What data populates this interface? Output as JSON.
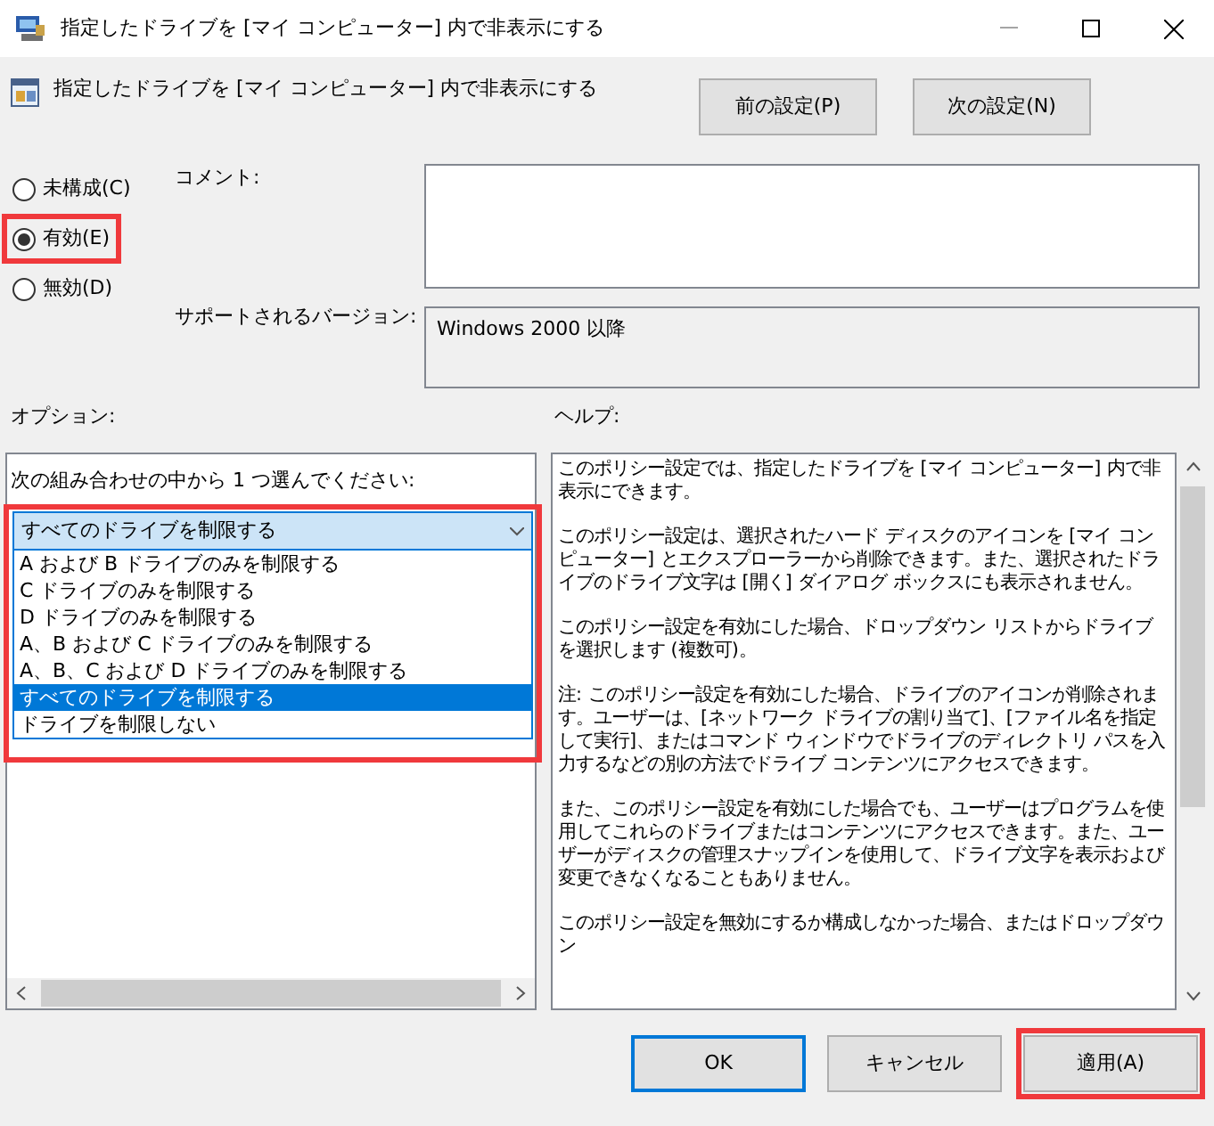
{
  "window": {
    "title": "指定したドライブを [マイ コンピューター] 内で非表示にする"
  },
  "header": {
    "policy_title": "指定したドライブを [マイ コンピューター] 内で非表示にする",
    "buttons": [
      {
        "label": "前の設定(P)"
      },
      {
        "label": "次の設定(N)"
      }
    ]
  },
  "state_options": [
    {
      "label": "未構成(C)",
      "selected": false,
      "highlighted": false
    },
    {
      "label": "有効(E)",
      "selected": true,
      "highlighted": true
    },
    {
      "label": "無効(D)",
      "selected": false,
      "highlighted": false
    }
  ],
  "comment": {
    "label": "コメント:"
  },
  "supported": {
    "label": "サポートされるバージョン:",
    "value": "Windows 2000 以降"
  },
  "options": {
    "label": "オプション:",
    "prompt": "次の組み合わせの中から 1 つ選んでください:",
    "dropdown": {
      "value": "すべてのドライブを制限する",
      "highlighted": true,
      "expanded": true,
      "items": [
        {
          "label": "A および B ドライブのみを制限する",
          "selected": false
        },
        {
          "label": "C ドライブのみを制限する",
          "selected": false
        },
        {
          "label": "D ドライブのみを制限する",
          "selected": false
        },
        {
          "label": "A、B および C ドライブのみを制限する",
          "selected": false
        },
        {
          "label": "A、B、C および D ドライブのみを制限する",
          "selected": false
        },
        {
          "label": "すべてのドライブを制限する",
          "selected": true
        },
        {
          "label": "ドライブを制限しない",
          "selected": false
        }
      ]
    }
  },
  "help": {
    "label": "ヘルプ:",
    "paragraphs": [
      "このポリシー設定では、指定したドライブを [マイ コンピューター] 内で非表示にできます。",
      "このポリシー設定は、選択されたハード ディスクのアイコンを [マイ コンピューター] とエクスプローラーから削除できます。また、選択されたドライブのドライブ文字は [開く] ダイアログ ボックスにも表示されません。",
      "このポリシー設定を有効にした場合、ドロップダウン リストからドライブを選択します (複数可)。",
      "注: このポリシー設定を有効にした場合、ドライブのアイコンが削除されます。ユーザーは、[ネットワーク ドライブの割り当て]、[ファイル名を指定して実行]、またはコマンド ウィンドウでドライブのディレクトリ パスを入力するなどの別の方法でドライブ コンテンツにアクセスできます。",
      "また、このポリシー設定を有効にした場合でも、ユーザーはプログラムを使用してこれらのドライブまたはコンテンツにアクセスできます。また、ユーザーがディスクの管理スナップインを使用して、ドライブ文字を表示および変更できなくなることもありません。",
      "このポリシー設定を無効にするか構成しなかった場合、またはドロップダウン"
    ]
  },
  "footer": {
    "buttons": [
      {
        "label": "OK",
        "kind": "default",
        "highlighted": false
      },
      {
        "label": "キャンセル",
        "kind": "normal",
        "highlighted": false
      },
      {
        "label": "適用(A)",
        "kind": "normal",
        "highlighted": true
      }
    ]
  }
}
